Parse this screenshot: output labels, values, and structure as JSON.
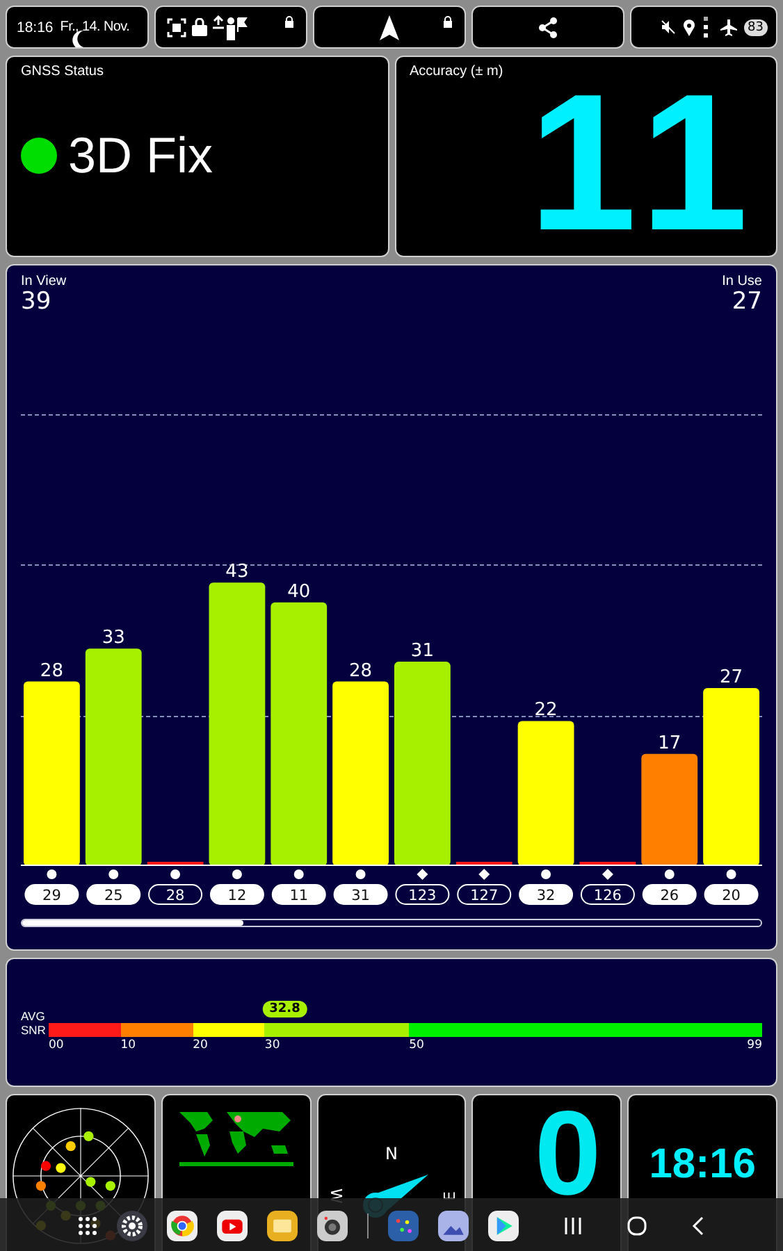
{
  "status_bar": {
    "time": "18:16",
    "date": "Fr., 14. Nov.",
    "battery": "83"
  },
  "gnss_status": {
    "title": "GNSS Status",
    "value": "3D Fix",
    "color": "#00dd00"
  },
  "accuracy": {
    "title": "Accuracy (± m)",
    "value": "11"
  },
  "satellites": {
    "in_view_label": "In View",
    "in_view": "39",
    "in_use_label": "In Use",
    "in_use": "27",
    "chart_data": {
      "type": "bar",
      "categories": [
        "29",
        "25",
        "28",
        "12",
        "11",
        "31",
        "123",
        "127",
        "32",
        "126",
        "26",
        "20"
      ],
      "values": [
        28,
        33,
        0,
        43,
        40,
        28,
        31,
        0,
        22,
        0,
        17,
        27
      ],
      "value_labels": [
        "28",
        "33",
        null,
        "43",
        "40",
        "28",
        "31",
        null,
        "22",
        null,
        "17",
        "27"
      ]
    },
    "items": [
      {
        "used": true,
        "kind": "circle"
      },
      {
        "used": true,
        "kind": "circle"
      },
      {
        "used": false,
        "kind": "circle"
      },
      {
        "used": true,
        "kind": "circle"
      },
      {
        "used": true,
        "kind": "circle"
      },
      {
        "used": true,
        "kind": "circle"
      },
      {
        "used": false,
        "kind": "diamond"
      },
      {
        "used": false,
        "kind": "diamond"
      },
      {
        "used": true,
        "kind": "circle"
      },
      {
        "used": false,
        "kind": "diamond"
      },
      {
        "used": true,
        "kind": "circle"
      },
      {
        "used": true,
        "kind": "circle"
      }
    ]
  },
  "snr": {
    "label_1": "AVG",
    "label_2": "SNR",
    "ticks": [
      "00",
      "10",
      "20",
      "30",
      "50",
      "99"
    ],
    "reading": "32.8",
    "level": 0.331
  },
  "tiles": {
    "compass": {
      "north": "N",
      "west": "W",
      "east": "E"
    },
    "speed": "0",
    "clock": "18:16"
  }
}
